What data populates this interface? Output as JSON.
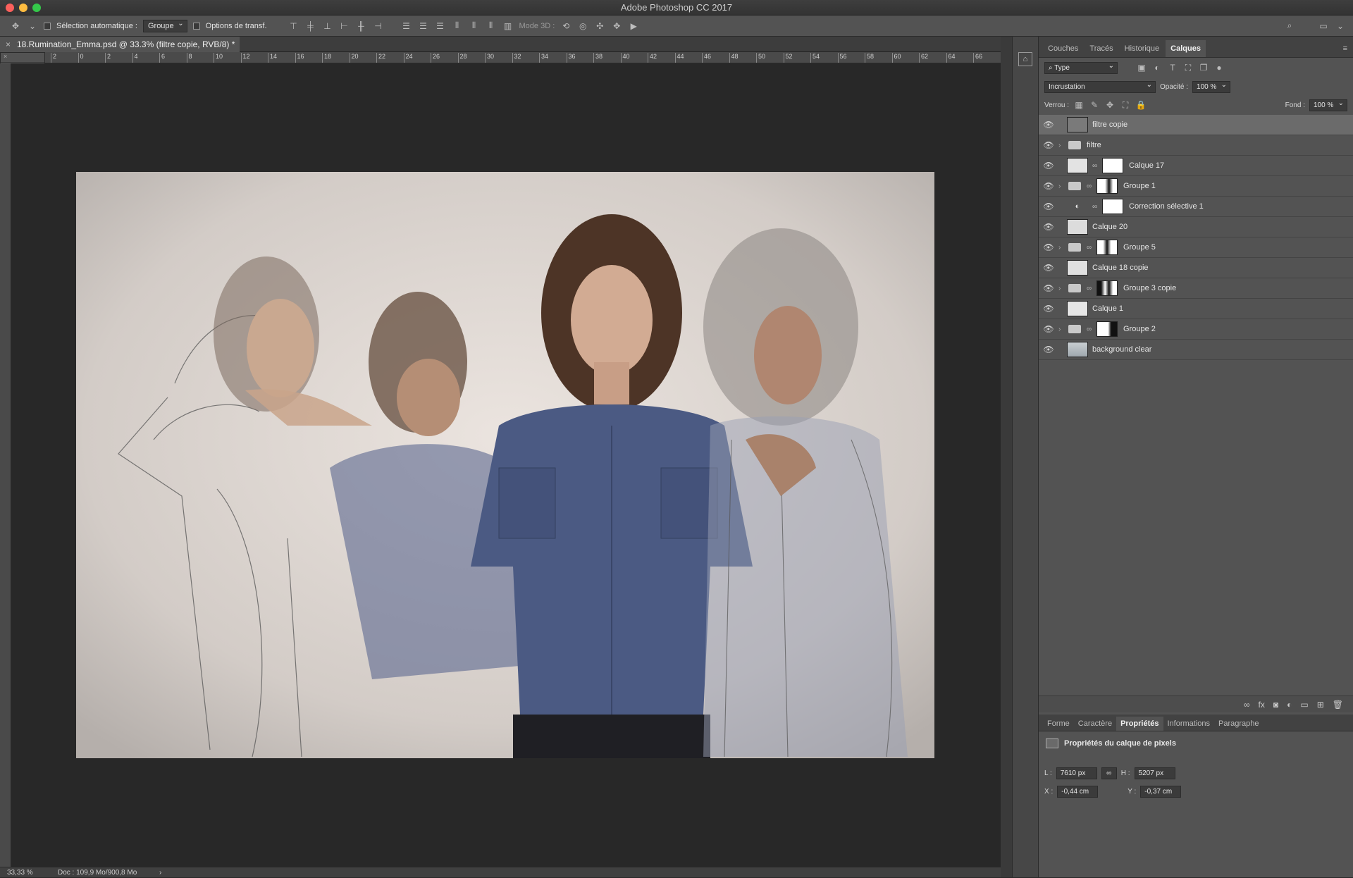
{
  "app": {
    "title": "Adobe Photoshop CC 2017"
  },
  "options": {
    "auto_select_label": "Sélection automatique :",
    "auto_select_value": "Groupe",
    "transform_label": "Options de transf.",
    "mode3d_label": "Mode 3D :"
  },
  "document": {
    "tab_title": "18.Rumination_Emma.psd @ 33.3% (filtre copie, RVB/8) *",
    "zoom": "33,33 %",
    "doc_info": "Doc : 109,9 Mo/900,8 Mo"
  },
  "ruler": {
    "top_ticks": [
      "2",
      "0",
      "2",
      "4",
      "6",
      "8",
      "10",
      "12",
      "14",
      "16",
      "18",
      "20",
      "22",
      "24",
      "26",
      "28",
      "30",
      "32",
      "34",
      "36",
      "38",
      "40",
      "42",
      "44",
      "46",
      "48",
      "50",
      "52",
      "54",
      "56",
      "58",
      "60",
      "62",
      "64",
      "66"
    ]
  },
  "layers_panel": {
    "tabs": [
      "Couches",
      "Tracés",
      "Historique",
      "Calques"
    ],
    "active_tab": "Calques",
    "filter_kind": "Type",
    "blend_mode": "Incrustation",
    "opacity_label": "Opacité :",
    "opacity_value": "100 %",
    "lock_label": "Verrou :",
    "fill_label": "Fond :",
    "fill_value": "100 %",
    "layers": [
      {
        "name": "filtre copie",
        "kind": "pixel",
        "selected": true
      },
      {
        "name": "filtre",
        "kind": "group"
      },
      {
        "name": "Calque 17",
        "kind": "pixel-mask"
      },
      {
        "name": "Groupe 1",
        "kind": "group-mask"
      },
      {
        "name": "Correction sélective 1",
        "kind": "adjustment"
      },
      {
        "name": "Calque 20",
        "kind": "pixel"
      },
      {
        "name": "Groupe 5",
        "kind": "group-mask"
      },
      {
        "name": "Calque 18 copie",
        "kind": "pixel"
      },
      {
        "name": "Groupe 3 copie",
        "kind": "group-mask"
      },
      {
        "name": "Calque 1",
        "kind": "pixel"
      },
      {
        "name": "Groupe 2",
        "kind": "group-mask"
      },
      {
        "name": "background clear",
        "kind": "pixel"
      }
    ]
  },
  "properties_panel": {
    "tabs": [
      "Forme",
      "Caractère",
      "Propriétés",
      "Informations",
      "Paragraphe"
    ],
    "active_tab": "Propriétés",
    "heading": "Propriétés du calque de pixels",
    "w_label": "L :",
    "w_value": "7610 px",
    "h_label": "H :",
    "h_value": "5207 px",
    "x_label": "X :",
    "x_value": "-0,44 cm",
    "y_label": "Y :",
    "y_value": "-0,37 cm"
  },
  "colors": {
    "panel": "#535353",
    "dark": "#282828",
    "selected_row": "#6b6b6b"
  }
}
